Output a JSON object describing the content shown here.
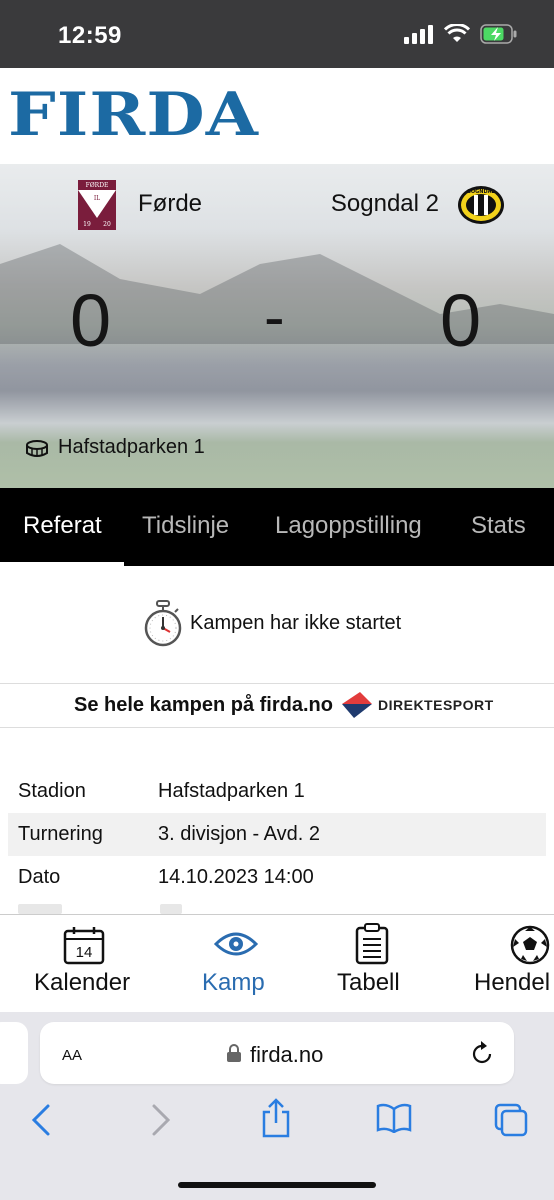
{
  "status_bar": {
    "time": "12:59"
  },
  "site": {
    "logo": "FIRDA"
  },
  "match": {
    "home_team": "Førde",
    "away_team": "Sogndal 2",
    "home_score": "0",
    "separator": "-",
    "away_score": "0",
    "venue": "Hafstadparken 1",
    "home_logo_text": {
      "top": "FØRDE",
      "mid": "IL",
      "left": "19",
      "right": "20"
    },
    "away_logo_text": "SOGNDAL"
  },
  "tabs": [
    {
      "label": "Referat"
    },
    {
      "label": "Tidslinje"
    },
    {
      "label": "Lagoppstilling"
    },
    {
      "label": "Stats"
    }
  ],
  "match_status": "Kampen har ikke startet",
  "stream_banner": {
    "text": "Se hele kampen på firda.no",
    "brand_a": "DIREKTE",
    "brand_b": "SPORT"
  },
  "info": [
    {
      "label": "Stadion",
      "value": "Hafstadparken 1"
    },
    {
      "label": "Turnering",
      "value": "3. divisjon - Avd. 2"
    },
    {
      "label": "Dato",
      "value": "14.10.2023 14:00"
    }
  ],
  "bottom_nav": {
    "calendar_day": "14",
    "items": [
      {
        "label": "Kalender"
      },
      {
        "label": "Kamp"
      },
      {
        "label": "Tabell"
      },
      {
        "label": "Hendel"
      }
    ]
  },
  "browser": {
    "aa": "AA",
    "url": "firda.no"
  },
  "colors": {
    "brand_blue": "#1c6aa3",
    "accent_blue": "#2a6cb0",
    "tab_bg": "#000000"
  }
}
